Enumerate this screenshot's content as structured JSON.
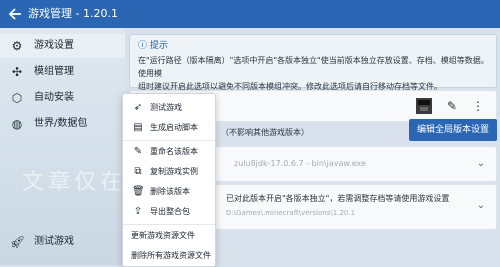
{
  "app": {
    "title": "游戏管理 - 1.20.1"
  },
  "sidebar": {
    "items": [
      {
        "label": "游戏设置",
        "icon": "gear-icon"
      },
      {
        "label": "模组管理",
        "icon": "puzzle-icon"
      },
      {
        "label": "自动安装",
        "icon": "package-icon"
      },
      {
        "label": "世界/数据包",
        "icon": "globe-icon"
      }
    ],
    "test_game_label": "测试游戏"
  },
  "tip": {
    "heading": "提示",
    "line1": "在\"运行路径（版本隔离）\"选项中开启\"各版本独立\"使当前版本独立存放设置、存档、模组等数据。使用模",
    "line2": "组时建议开启此选项以避免不同版本模组冲突。修改此选项后请自行移动存档等文件。"
  },
  "main": {
    "isolation_note": "（不影响其他游戏版本）",
    "edit_global_button": "编辑全局版本设置",
    "java_path": "zulu8jdk-17.0.6.7 - bin\\javaw.exe",
    "isolation_line1": "已对此版本开启\"各版本独立\"，若需调整存档等请使用游戏设置",
    "isolation_line2": "D:\\Games\\.minecraft\\versions\\1.20.1"
  },
  "context_menu": {
    "items": [
      {
        "label": "测试游戏",
        "icon": "rocket-icon"
      },
      {
        "label": "生成启动脚本",
        "icon": "script-icon"
      },
      {
        "label": "重命名该版本",
        "icon": "pencil-icon"
      },
      {
        "label": "复制游戏实例",
        "icon": "copy-icon"
      },
      {
        "label": "删除该版本",
        "icon": "trash-icon"
      },
      {
        "label": "导出整合包",
        "icon": "export-icon"
      },
      {
        "label": "更新游戏资源文件",
        "icon": ""
      },
      {
        "label": "删除所有游戏资源文件",
        "icon": ""
      }
    ]
  },
  "watermark": "文章仅在全"
}
